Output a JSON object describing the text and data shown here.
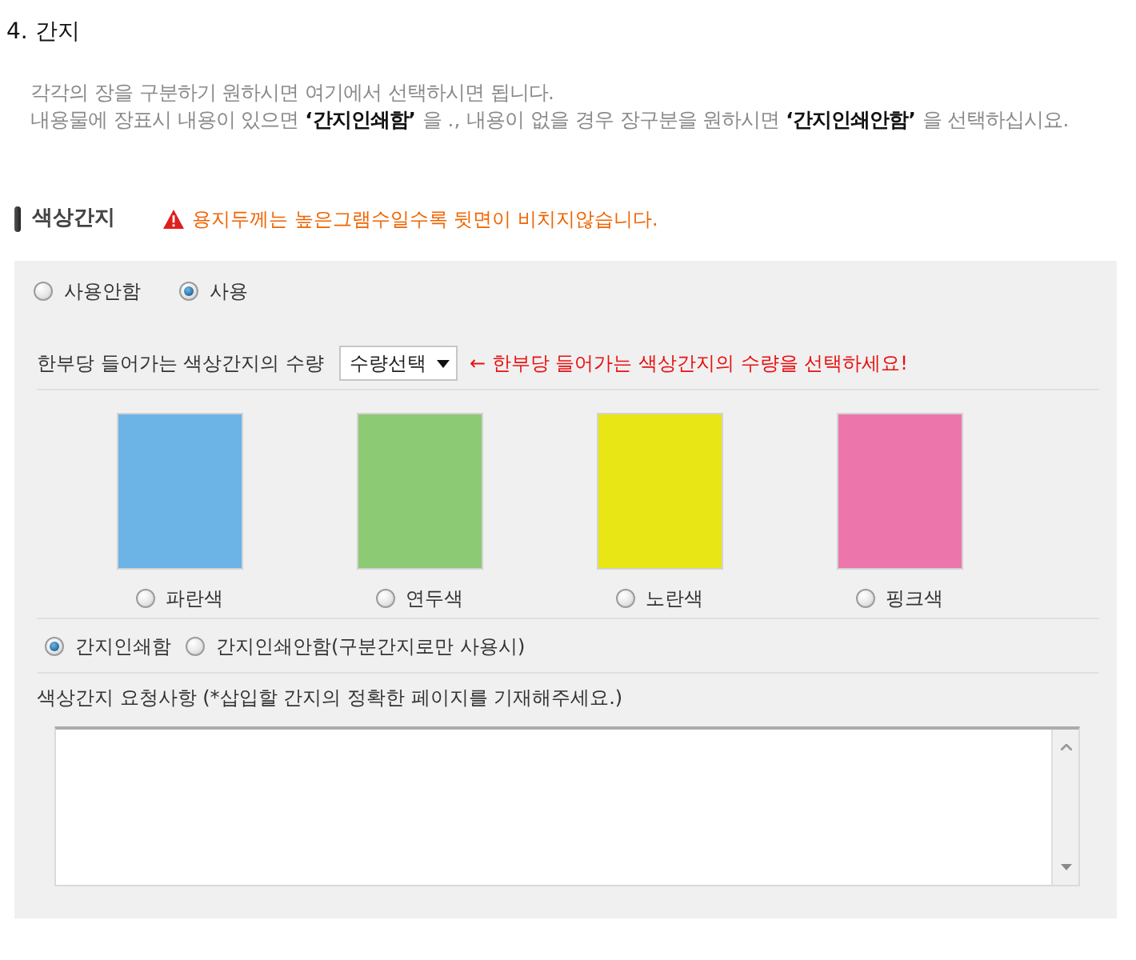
{
  "section": {
    "title": "4. 간지",
    "description": [
      "각각의 장을 구분하기 원하시면 여기에서 선택하시면 됩니다.",
      "내용물에 장표시 내용이 있으면 **‘간지인쇄함’** 을 ., 내용이 없을 경우 장구분을 원하시면 **‘간지인쇄안함’** 을 선택하십시요."
    ]
  },
  "color_divider": {
    "title": "색상간지",
    "warning": "용지두께는 높은그램수일수록 뒷면이 비치지않습니다.",
    "usage_options": [
      {
        "label": "사용안함",
        "selected": false
      },
      {
        "label": "사용",
        "selected": true
      }
    ],
    "quantity": {
      "label": "한부당 들어가는 색상간지의 수량",
      "select_value": "수량선택",
      "hint": "← 한부당 들어가는 색상간지의 수량을 선택하세요!"
    },
    "colors": [
      {
        "label": "파란색",
        "color": "#6db4e6",
        "selected": false
      },
      {
        "label": "연두색",
        "color": "#8cca74",
        "selected": false
      },
      {
        "label": "노란색",
        "color": "#e8e614",
        "selected": false
      },
      {
        "label": "핑크색",
        "color": "#ec76ac",
        "selected": false
      }
    ],
    "print_options": [
      {
        "label": "간지인쇄함",
        "selected": true
      },
      {
        "label": "간지인쇄안함(구분간지로만 사용시)",
        "selected": false
      }
    ],
    "request": {
      "label": "색상간지 요청사항 (*삽입할 간지의 정확한 페이지를 기재해주세요.)"
    }
  }
}
